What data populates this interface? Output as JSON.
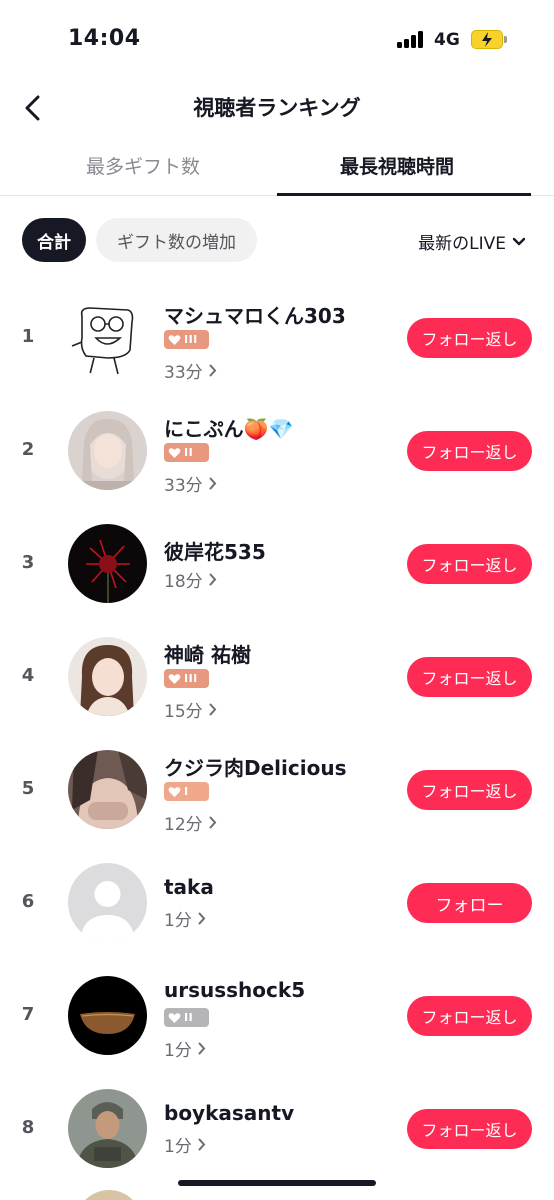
{
  "status_bar": {
    "time": "14:04",
    "network": "4G"
  },
  "header": {
    "title": "視聴者ランキング",
    "back_icon": "chevron-left-icon"
  },
  "tabs": [
    {
      "label": "最多ギフト数",
      "active": false
    },
    {
      "label": "最長視聴時間",
      "active": true
    }
  ],
  "filters": {
    "total_label": "合計",
    "gift_increase_label": "ギフト数の増加",
    "sort_label": "最新のLIVE",
    "sort_icon": "chevron-down-icon"
  },
  "colors": {
    "accent": "#fe2c55",
    "badge_orange": "#e8987e",
    "badge_light_orange": "#f0a88a",
    "badge_gray": "#b5b5b8"
  },
  "viewers": [
    {
      "rank": "1",
      "name": "マシュマロくん303",
      "badge_level": "III",
      "badge_color": "orange",
      "duration": "33分",
      "follow_label": "フォロー返し"
    },
    {
      "rank": "2",
      "name": "にこぷん🍑💎",
      "badge_level": "II",
      "badge_color": "orange",
      "duration": "33分",
      "follow_label": "フォロー返し"
    },
    {
      "rank": "3",
      "name": "彼岸花535",
      "badge_level": "",
      "badge_color": "",
      "duration": "18分",
      "follow_label": "フォロー返し"
    },
    {
      "rank": "4",
      "name": "神崎 祐樹",
      "badge_level": "III",
      "badge_color": "orange",
      "duration": "15分",
      "follow_label": "フォロー返し"
    },
    {
      "rank": "5",
      "name": "クジラ肉Delicious",
      "badge_level": "I",
      "badge_color": "light-orange",
      "duration": "12分",
      "follow_label": "フォロー返し"
    },
    {
      "rank": "6",
      "name": "taka",
      "badge_level": "",
      "badge_color": "",
      "duration": "1分",
      "follow_label": "フォロー"
    },
    {
      "rank": "7",
      "name": "ursusshock5",
      "badge_level": "II",
      "badge_color": "gray",
      "duration": "1分",
      "follow_label": "フォロー返し"
    },
    {
      "rank": "8",
      "name": "boykasantv",
      "badge_level": "",
      "badge_color": "",
      "duration": "1分",
      "follow_label": "フォロー返し"
    }
  ]
}
